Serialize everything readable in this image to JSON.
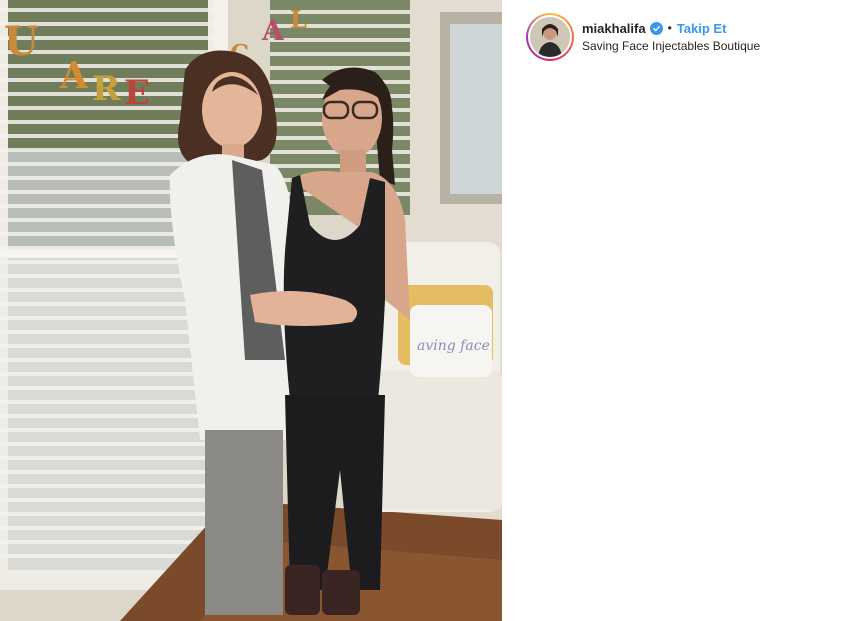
{
  "post": {
    "username": "miakhalifa",
    "separator": "•",
    "follow_label": "Takip Et",
    "location": "Saving Face Injectables Boutique",
    "verified_icon": "verified-badge-icon"
  },
  "photo": {
    "banner_text": "U ARE MAGICAL",
    "pillow_text": "aving face"
  },
  "colors": {
    "link_blue": "#3897f0",
    "text_dark": "#262626"
  }
}
